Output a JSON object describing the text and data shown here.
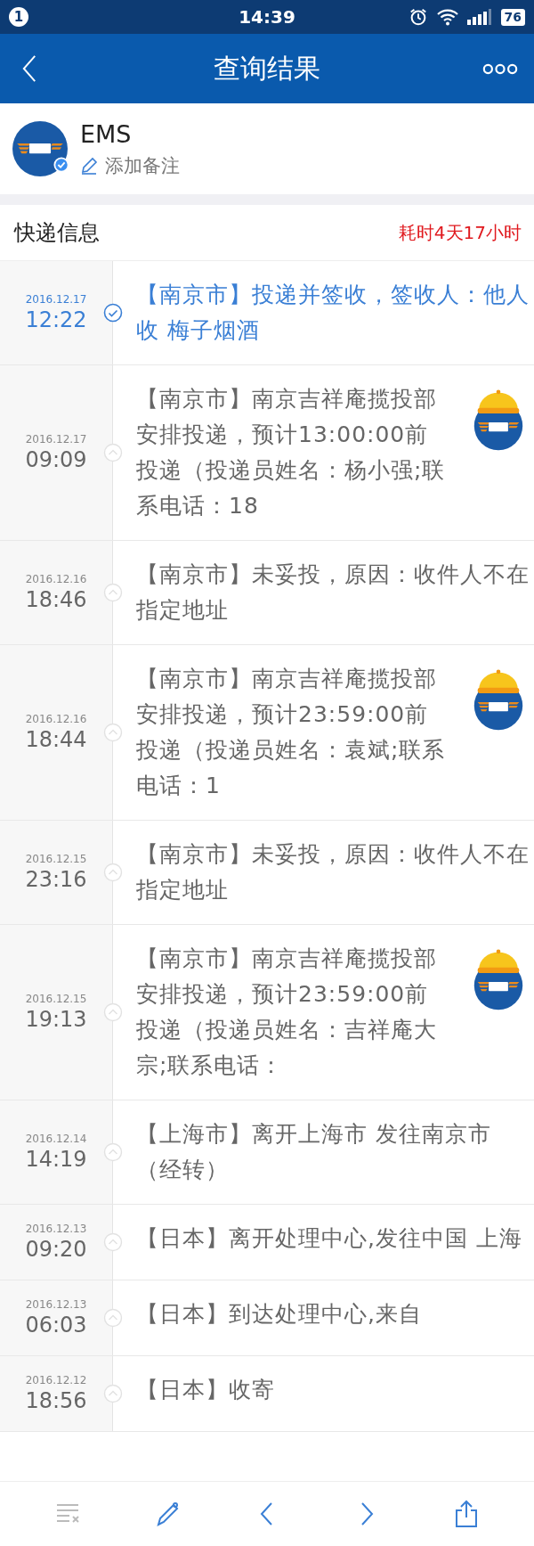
{
  "status_bar": {
    "notification_count": "1",
    "time": "14:39",
    "battery": "76"
  },
  "nav_bar": {
    "title": "查询结果"
  },
  "shipment": {
    "carrier": "EMS",
    "verified": true,
    "note_link": "添加备注"
  },
  "section": {
    "title": "快递信息",
    "duration": "耗时4天17小时"
  },
  "events": [
    {
      "date": "2016.12.17",
      "time": "12:22",
      "text": "【南京市】投递并签收，签收人：他人收 梅子烟酒",
      "latest": true,
      "courier": false
    },
    {
      "date": "2016.12.17",
      "time": "09:09",
      "text": "【南京市】南京吉祥庵揽投部安排投递，预计13:00:00前投递（投递员姓名：杨小强;联系电话：18",
      "latest": false,
      "courier": true
    },
    {
      "date": "2016.12.16",
      "time": "18:46",
      "text": "【南京市】未妥投，原因：收件人不在指定地址",
      "latest": false,
      "courier": false
    },
    {
      "date": "2016.12.16",
      "time": "18:44",
      "text": "【南京市】南京吉祥庵揽投部安排投递，预计23:59:00前投递（投递员姓名：袁斌;联系电话：1",
      "latest": false,
      "courier": true
    },
    {
      "date": "2016.12.15",
      "time": "23:16",
      "text": "【南京市】未妥投，原因：收件人不在指定地址",
      "latest": false,
      "courier": false
    },
    {
      "date": "2016.12.15",
      "time": "19:13",
      "text": "【南京市】南京吉祥庵揽投部安排投递，预计23:59:00前投递（投递员姓名：吉祥庵大宗;联系电话：",
      "latest": false,
      "courier": true
    },
    {
      "date": "2016.12.14",
      "time": "14:19",
      "text": "【上海市】离开上海市 发往南京市（经转）",
      "latest": false,
      "courier": false
    },
    {
      "date": "2016.12.13",
      "time": "09:20",
      "text": "【日本】离开处理中心,发往中国 上海",
      "latest": false,
      "courier": false
    },
    {
      "date": "2016.12.13",
      "time": "06:03",
      "text": "【日本】到达处理中心,来自",
      "latest": false,
      "courier": false
    },
    {
      "date": "2016.12.12",
      "time": "18:56",
      "text": "【日本】收寄",
      "latest": false,
      "courier": false
    }
  ],
  "toolbar": [
    {
      "kind": "clear",
      "disabled": true
    },
    {
      "kind": "edit",
      "disabled": false
    },
    {
      "kind": "previous",
      "disabled": false
    },
    {
      "kind": "next",
      "disabled": false
    },
    {
      "kind": "share",
      "disabled": false
    }
  ]
}
